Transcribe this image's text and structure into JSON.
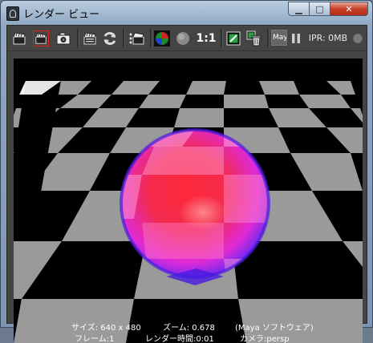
{
  "window": {
    "title": "レンダー ビュー"
  },
  "toolbar": {
    "ratio_label": "1:1",
    "renderer_label": "Maya",
    "ipr_label": "IPR: 0MB"
  },
  "info": {
    "size": "サイズ: 640 x 480",
    "zoom": "ズーム: 0.678",
    "renderer": "(Maya ソフトウェア)",
    "frame": "フレーム:1",
    "render_time": "レンダー時間:0:01",
    "camera": "カメラ:persp"
  }
}
